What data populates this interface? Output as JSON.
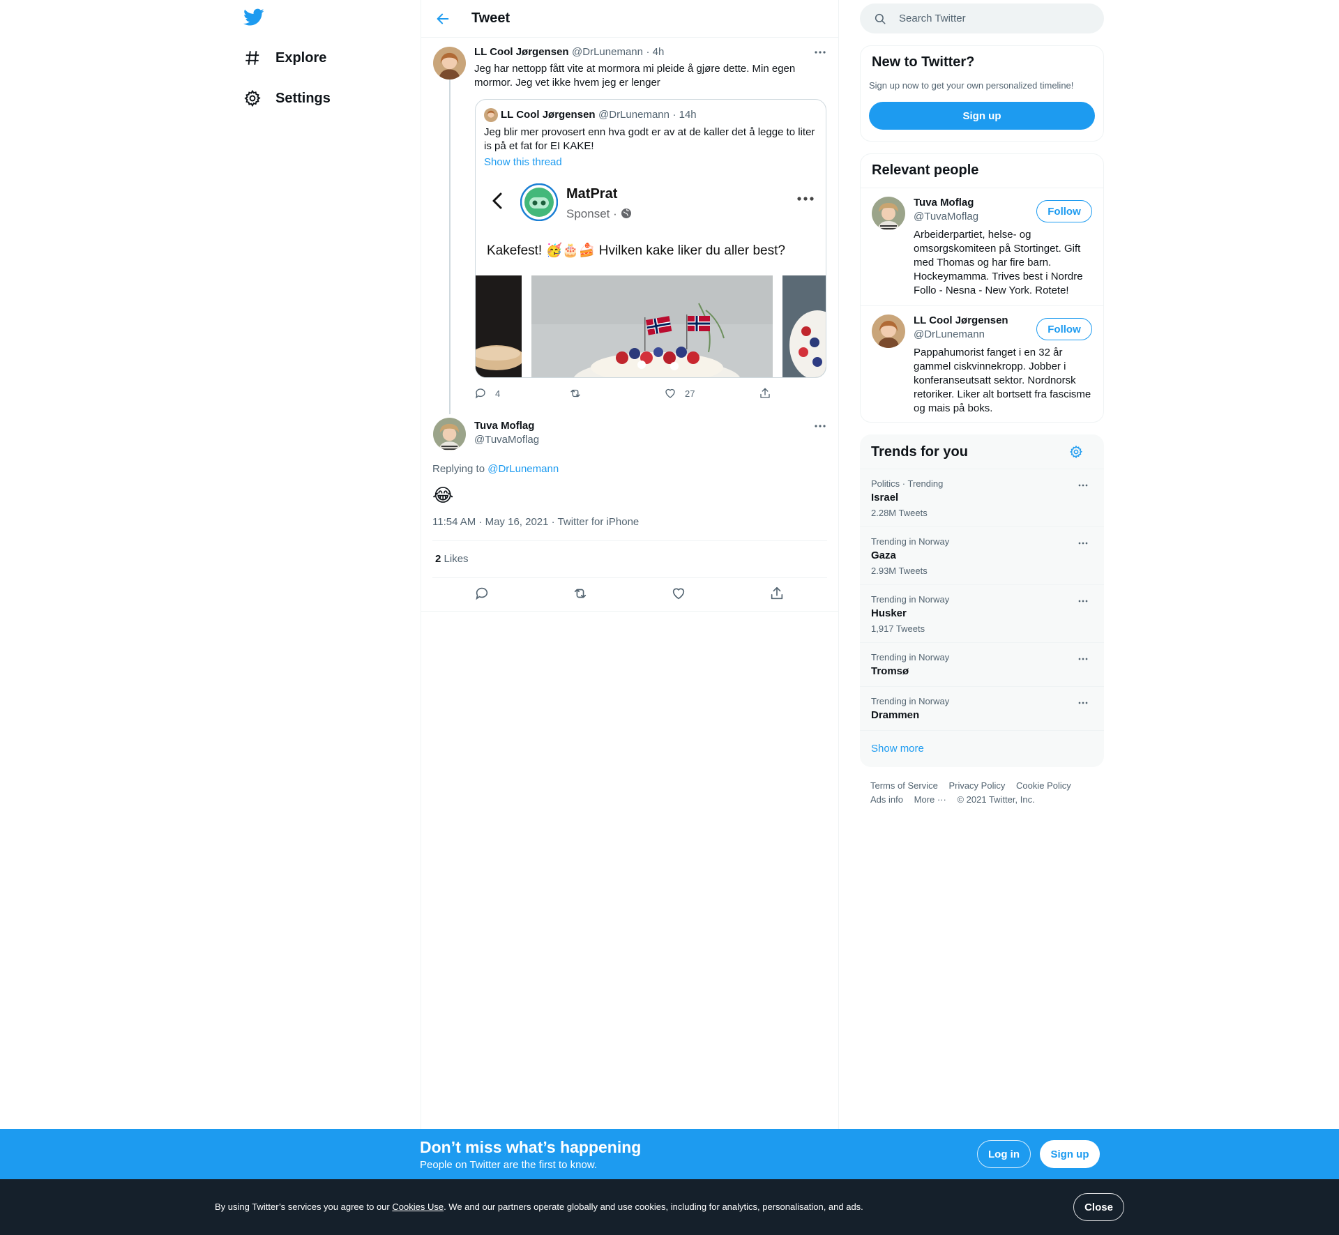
{
  "nav": {
    "items": [
      {
        "label": "Explore",
        "icon": "hashtag-icon"
      },
      {
        "label": "Settings",
        "icon": "gear-icon"
      }
    ]
  },
  "header": {
    "title": "Tweet"
  },
  "parent_tweet": {
    "name": "LL Cool Jørgensen",
    "handle": "@DrLunemann",
    "time": "· 4h",
    "text": "Jeg har nettopp fått vite at mormora mi pleide å gjøre dette. Min egen mormor. Jeg vet ikke hvem jeg er lenger",
    "quote": {
      "name": "LL Cool Jørgensen",
      "handle": "@DrLunemann",
      "time": "· 14h",
      "text": "Jeg blir mer provosert enn hva godt er av at de kaller det å legge to liter is på et fat for EI KAKE!",
      "show_thread": "Show this thread",
      "media": {
        "page_name": "MatPrat",
        "page_sub": "Sponset ·",
        "post_text": "Kakefest! 🥳🎂🍰 Hvilken kake liker du aller best?"
      }
    },
    "actions": {
      "replies": "4",
      "retweets": "",
      "likes": "27"
    }
  },
  "main_tweet": {
    "name": "Tuva Moflag",
    "handle": "@TuvaMoflag",
    "replying_prefix": "Replying to",
    "replying_to": "@DrLunemann",
    "text": "😂",
    "meta": "11:54 AM · May 16, 2021 · Twitter for iPhone",
    "likes_count": "2",
    "likes_label": "Likes"
  },
  "search": {
    "placeholder": "Search Twitter"
  },
  "new_to_twitter": {
    "title": "New to Twitter?",
    "subtitle": "Sign up now to get your own personalized timeline!",
    "button": "Sign up"
  },
  "relevant_people": {
    "title": "Relevant people",
    "people": [
      {
        "name": "Tuva Moflag",
        "handle": "@TuvaMoflag",
        "follow": "Follow",
        "bio": "Arbeiderpartiet, helse- og omsorgskomiteen på Stortinget. Gift med Thomas og har fire barn. Hockeymamma. Trives best i Nordre Follo - Nesna - New York. Rotete!"
      },
      {
        "name": "LL Cool Jørgensen",
        "handle": "@DrLunemann",
        "follow": "Follow",
        "bio": "Pappahumorist fanget i en 32 år gammel ciskvinnekropp. Jobber i konferanseutsatt sektor. Nordnorsk retoriker. Liker alt bortsett fra fascisme og mais på boks."
      }
    ]
  },
  "trends": {
    "title": "Trends for you",
    "items": [
      {
        "context": "Politics · Trending",
        "name": "Israel",
        "count": "2.28M Tweets"
      },
      {
        "context": "Trending in Norway",
        "name": "Gaza",
        "count": "2.93M Tweets"
      },
      {
        "context": "Trending in Norway",
        "name": "Husker",
        "count": "1,917 Tweets"
      },
      {
        "context": "Trending in Norway",
        "name": "Tromsø",
        "count": ""
      },
      {
        "context": "Trending in Norway",
        "name": "Drammen",
        "count": ""
      }
    ],
    "show_more": "Show more"
  },
  "footer": {
    "links": [
      "Terms of Service",
      "Privacy Policy",
      "Cookie Policy"
    ],
    "links2": [
      "Ads info",
      "More ···"
    ],
    "copyright": "© 2021 Twitter, Inc."
  },
  "promo": {
    "title": "Don’t miss what’s happening",
    "subtitle": "People on Twitter are the first to know.",
    "login": "Log in",
    "signup": "Sign up"
  },
  "cookie": {
    "prefix": "By using Twitter’s services you agree to our",
    "link": "Cookies Use",
    "suffix": ". We and our partners operate globally and use cookies, including for analytics, personalisation, and ads.",
    "close": "Close"
  },
  "colors": {
    "brand": "#1d9bf0",
    "text": "#0f1419",
    "muted": "#536471",
    "cookie_bg": "#15202b"
  }
}
